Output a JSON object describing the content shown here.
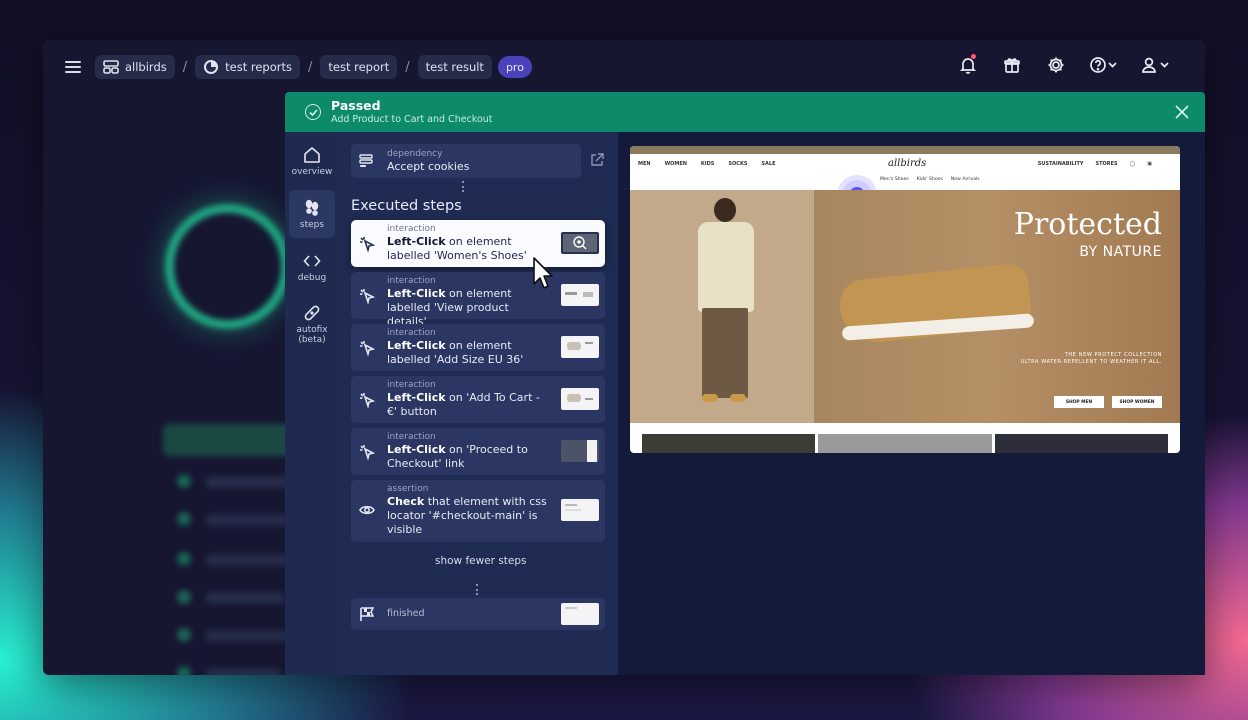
{
  "breadcrumbs": {
    "project": "allbirds",
    "reports": "test reports",
    "report": "test report",
    "result": "test result",
    "badge": "pro",
    "separator": "/"
  },
  "topbar_icons": [
    "bell-icon",
    "gift-icon",
    "gear-icon",
    "help-icon",
    "user-icon"
  ],
  "modal": {
    "status": "Passed",
    "test_name": "Add Product to Cart and Checkout",
    "nav": [
      {
        "label": "overview",
        "icon": "home-icon"
      },
      {
        "label": "steps",
        "icon": "footprints-icon"
      },
      {
        "label": "debug",
        "icon": "code-icon"
      },
      {
        "label": "autofix (beta)",
        "icon": "bandage-icon"
      }
    ],
    "dependency": {
      "kind": "dependency",
      "name": "Accept cookies"
    },
    "executed_title": "Executed steps",
    "steps": [
      {
        "kind": "interaction",
        "action": "Left-Click",
        "rest": " on element labelled 'Women's Shoes'",
        "icon": "click-icon"
      },
      {
        "kind": "interaction",
        "action": "Left-Click",
        "rest": " on element labelled 'View product details'",
        "icon": "click-icon"
      },
      {
        "kind": "interaction",
        "action": "Left-Click",
        "rest": " on element labelled 'Add Size EU 36'",
        "icon": "click-icon"
      },
      {
        "kind": "interaction",
        "action": "Left-Click",
        "rest": " on 'Add To Cart - €' button",
        "icon": "click-icon"
      },
      {
        "kind": "interaction",
        "action": "Left-Click",
        "rest": " on 'Proceed to Checkout' link",
        "icon": "click-icon"
      },
      {
        "kind": "assertion",
        "action": "Check",
        "rest": " that element with css locator '#checkout-main' is visible",
        "icon": "eye-icon"
      }
    ],
    "show_fewer": "show fewer steps",
    "finished": "finished"
  },
  "site": {
    "logo": "allbirds",
    "nav_left": [
      "MEN",
      "WOMEN",
      "KIDS",
      "SOCKS",
      "SALE"
    ],
    "nav_right": [
      "SUSTAINABILITY",
      "STORES"
    ],
    "subnav": [
      "Men's Shoes",
      "Kids' Shoes",
      "New Arrivals"
    ],
    "hero_title": "Protected",
    "hero_sub": "BY NATURE",
    "hero_copy_1": "THE NEW PROTECT COLLECTION",
    "hero_copy_2": "ULTRA WATER-REPELLENT TO WEATHER IT ALL.",
    "btn_men": "SHOP MEN",
    "btn_women": "SHOP WOMEN"
  },
  "colors": {
    "accent_green": "#0c8a6a",
    "pro_badge": "#4a42b8",
    "panel": "#1f2b52"
  }
}
